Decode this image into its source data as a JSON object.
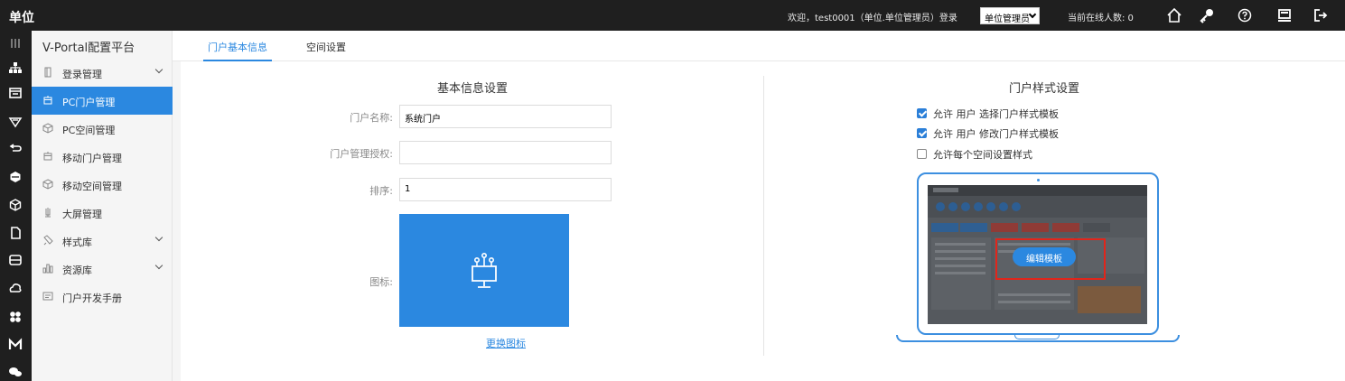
{
  "topbar": {
    "brand": "单位",
    "welcome": "欢迎，test0001（单位.单位管理员）登录",
    "role_select": "单位管理员",
    "online_count": "当前在线人数: 0",
    "icons": [
      "home-icon",
      "key-icon",
      "help-icon",
      "monitor-icon",
      "book-icon",
      "logout-icon"
    ]
  },
  "rail": {
    "icons": [
      "menu-icon",
      "org-icon",
      "dashboard-icon",
      "portal-icon",
      "link-icon",
      "hex-icon",
      "cube-icon",
      "doc-icon",
      "db-icon",
      "cloud-icon",
      "apps-icon",
      "mail-icon",
      "chat-icon"
    ]
  },
  "menu": {
    "title": "V-Portal配置平台",
    "items": [
      {
        "label": "登录管理",
        "icon": "login-icon",
        "expandable": true,
        "active": false
      },
      {
        "label": "PC门户管理",
        "icon": "pc-portal-icon",
        "expandable": false,
        "active": true
      },
      {
        "label": "PC空间管理",
        "icon": "pc-space-icon",
        "expandable": false,
        "active": false
      },
      {
        "label": "移动门户管理",
        "icon": "mobile-portal-icon",
        "expandable": false,
        "active": false
      },
      {
        "label": "移动空间管理",
        "icon": "mobile-space-icon",
        "expandable": false,
        "active": false
      },
      {
        "label": "大屏管理",
        "icon": "screen-icon",
        "expandable": false,
        "active": false
      },
      {
        "label": "样式库",
        "icon": "style-icon",
        "expandable": true,
        "active": false
      },
      {
        "label": "资源库",
        "icon": "resource-icon",
        "expandable": true,
        "active": false
      },
      {
        "label": "门户开发手册",
        "icon": "manual-icon",
        "expandable": false,
        "active": false
      }
    ]
  },
  "tabs": [
    {
      "label": "门户基本信息",
      "active": true
    },
    {
      "label": "空间设置",
      "active": false
    }
  ],
  "basic": {
    "title": "基本信息设置",
    "name_label": "门户名称:",
    "name_value": "系统门户",
    "auth_label": "门户管理授权:",
    "auth_value": "",
    "order_label": "排序:",
    "order_value": "1",
    "icon_label": "图标:",
    "change_icon": "更换图标"
  },
  "style": {
    "title": "门户样式设置",
    "options": [
      {
        "label": "允许 用户 选择门户样式模板",
        "checked": true
      },
      {
        "label": "允许 用户 修改门户样式模板",
        "checked": true
      },
      {
        "label": "允许每个空间设置样式",
        "checked": false
      }
    ],
    "edit_button": "编辑模板"
  },
  "colors": {
    "accent": "#2b88e0",
    "highlight_frame": "#e1251b",
    "topbar": "#1f1f1f"
  }
}
